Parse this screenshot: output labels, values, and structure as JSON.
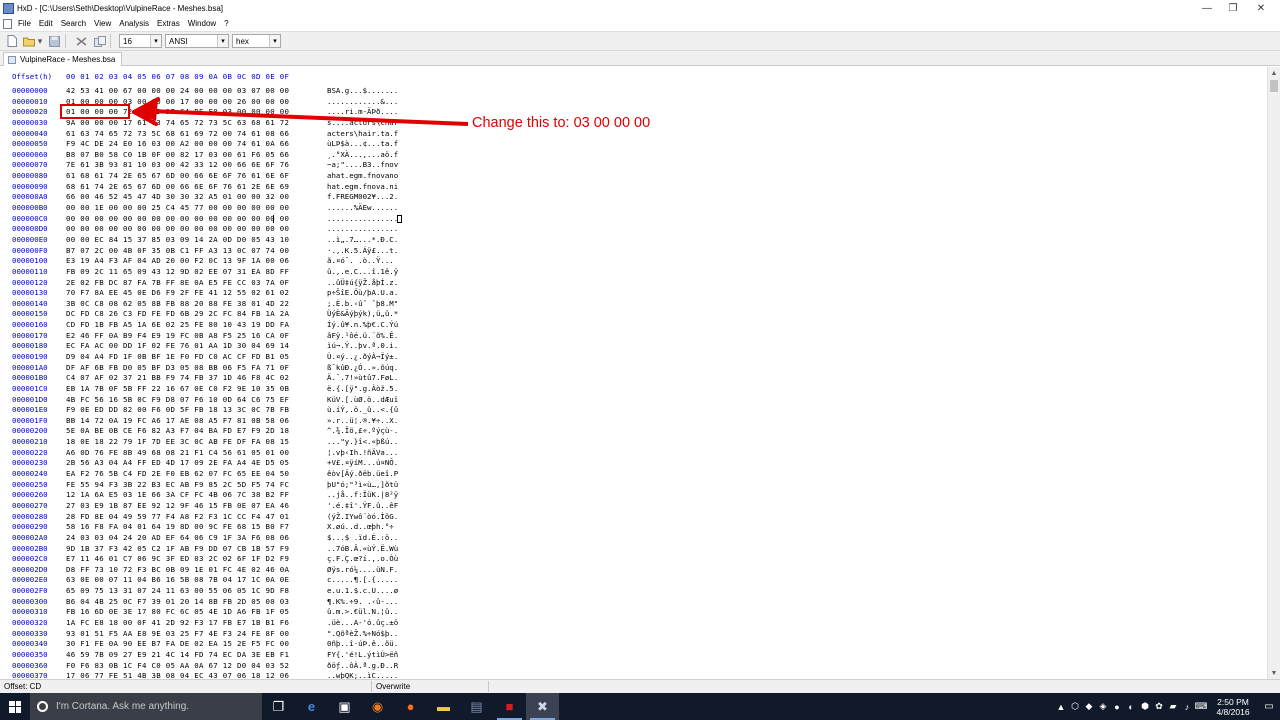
{
  "window": {
    "title": "HxD - [C:\\Users\\Seth\\Desktop\\VulpineRace - Meshes.bsa]",
    "controls": {
      "minimize": "—",
      "restore": "❐",
      "close": "✕"
    }
  },
  "menu": [
    "File",
    "Edit",
    "Search",
    "View",
    "Analysis",
    "Extras",
    "Window",
    "?"
  ],
  "toolbar": {
    "bytes_per_row": "16",
    "charset": "ANSI",
    "display_mode": "hex"
  },
  "tabs": [
    {
      "label": "VulpineRace - Meshes.bsa",
      "active": true
    }
  ],
  "hex_view": {
    "header_label": "Offset(h)",
    "columns": "00 01 02 03 04 05 06 07 08 09 0A 0B 0C 0D 0E 0F",
    "rows": [
      {
        "offset": "00000000",
        "hex": "42 53 41 00 67 00 00 00 24 00 00 00 03 07 00 00",
        "ascii": "BSA.g...$......."
      },
      {
        "offset": "00000010",
        "hex": "01 00 00 00 03 00 00 00 17 00 00 00 26 00 00 00",
        "ascii": "............&..."
      },
      {
        "offset": "00000020",
        "hex": "01 00 00 00 72 69 6D 97 C4 BE F0 03 00 00 00 00",
        "ascii": "....ri.m-ÄÞð...."
      },
      {
        "offset": "00000030",
        "hex": "9A 00 00 00 17 61 63 74 65 72 73 5C 63 68 61 72",
        "ascii": "š....actors\\char"
      },
      {
        "offset": "00000040",
        "hex": "61 63 74 65 72 73 5C 68 61 69 72 00 74 61 08 66",
        "ascii": "acters\\hair.ta.f"
      },
      {
        "offset": "00000050",
        "hex": "F9 4C DE 24 E0 16 03 00 A2 00 00 00 74 61 0A 66",
        "ascii": "ùLÞ$à...¢...ta.f"
      },
      {
        "offset": "00000060",
        "hex": "B8 07 B0 58 C0 1B 0F 00 82 17 03 00 61 F6 05 66",
        "ascii": "¸.°XÀ...‚...aö.f"
      },
      {
        "offset": "00000070",
        "hex": "7E 61 3B 93 81 10 03 00 42 33 12 00 66 6E 6F 76",
        "ascii": "~a;\"....B3..fnov"
      },
      {
        "offset": "00000080",
        "hex": "61 68 61 74 2E 65 67 6D 00 66 6E 6F 76 61 6E 6F",
        "ascii": "ahat.egm.fnovano"
      },
      {
        "offset": "00000090",
        "hex": "68 61 74 2E 65 67 6D 00 66 6E 6F 76 61 2E 6E 69",
        "ascii": "hat.egm.fnova.ni"
      },
      {
        "offset": "000000A0",
        "hex": "66 00 46 52 45 47 4D 30 30 32 A5 01 00 00 32 00",
        "ascii": "f.FREGM002¥...2."
      },
      {
        "offset": "000000B0",
        "hex": "00 00 1E 00 00 00 25 C4 45 77 00 00 00 00 00 00",
        "ascii": "......%ÄEw......"
      },
      {
        "offset": "000000C0",
        "hex": "00 00 00 00 00 00 00 00 00 00 00 00 00 00 00 00",
        "ascii": "................"
      },
      {
        "offset": "000000D0",
        "hex": "00 00 00 00 00 00 00 00 00 00 00 00 00 00 00 00",
        "ascii": "................"
      },
      {
        "offset": "000000E0",
        "hex": "00 00 EC 84 15 37 85 03 09 14 2A 0D D0 05 43 10",
        "ascii": "..ì„.7…...*.Ð.C."
      },
      {
        "offset": "000000F0",
        "hex": "B7 07 2C 00 4B 0F 35 0B C1 FF A3 13 0C 07 74 00",
        "ascii": "·.,.K.5.Áÿ£...t."
      },
      {
        "offset": "00000100",
        "hex": "E3 19 A4 F3 AF 04 AD 20 00 F2 0C 13 9F 1A 00 06",
        "ascii": "ã.¤ó¯.­ .ò..Ÿ..."
      },
      {
        "offset": "00000110",
        "hex": "FB 09 2C 11 65 09 43 12 9D 02 EE 07 31 EA 8D FF",
        "ascii": "û.,.e.C...î.1ê.ÿ"
      },
      {
        "offset": "00000120",
        "hex": "2E 02 FB DC 87 FA 7B FF 8E 0A E5 FE CC 03 7A 0F",
        "ascii": "..ûÜ‡ú{ÿŽ.åþÌ.z."
      },
      {
        "offset": "00000130",
        "hex": "70 F7 8A EE 45 0E D6 F9 2F FE 41 12 55 02 61 02",
        "ascii": "p÷ŠîE.Öù/þA.U.a."
      },
      {
        "offset": "00000140",
        "hex": "3B 0C C8 08 62 05 8B FB 88 20 88 FE 38 01 4D 22",
        "ascii": ";.È.b.‹ûˆ ˆþ8.M\""
      },
      {
        "offset": "00000150",
        "hex": "DC FD C8 26 C3 FD FE FD 6B 29 2C FC 84 FB 1A 2A",
        "ascii": "ÜýÈ&Ãýþýk),ü„û.*"
      },
      {
        "offset": "00000160",
        "hex": "CD FD 1B FB A5 1A 6E 02 25 FE 80 10 43 19 DD FA",
        "ascii": "Íý.û¥.n.%þ€.C.Ýú"
      },
      {
        "offset": "00000170",
        "hex": "E2 46 FF 0A B9 F4 E9 19 FC 0B A8 F5 25 16 CA 0F",
        "ascii": "âFÿ.¹ôé.ü.¨õ%.Ê."
      },
      {
        "offset": "00000180",
        "hex": "EC FA AC 00 DD 1F 02 FE 76 01 AA 1D 30 04 69 14",
        "ascii": "ìú¬.Ý..þv.ª.0.i."
      },
      {
        "offset": "00000190",
        "hex": "D9 04 A4 FD 1F 0B BF 1E F0 FD C0 AC CF FD B1 05",
        "ascii": "Ù.¤ý..¿.ðýÀ¬Ïý±."
      },
      {
        "offset": "000001A0",
        "hex": "DF AF 6B FB D0 05 BF D3 05 08 BB 06 F5 FA 71 0F",
        "ascii": "ß¯kûÐ.¿Ó..».õúq."
      },
      {
        "offset": "000001B0",
        "hex": "C4 07 AF 02 37 21 BB F9 74 FB 37 1D 46 F8 4C 02",
        "ascii": "Ä.¯.7!»ùtû7.FøL."
      },
      {
        "offset": "000001C0",
        "hex": "EB 1A 7B 0F 5B FF 22 16 67 0E C0 F2 9E 10 35 0B",
        "ascii": "ë.{.[ÿ\".g.Àòž.5."
      },
      {
        "offset": "000001D0",
        "hex": "4B FC 56 16 5B 0C F9 D8 07 F6 10 0D 64 C6 75 EF",
        "ascii": "KüV.[.ùØ.ö..dÆuï"
      },
      {
        "offset": "000001E0",
        "hex": "F9 0E ED DD 82 00 F6 0D 5F FB 18 13 3C 0C 7B FB",
        "ascii": "ù.íÝ‚.ö._û..<.{û"
      },
      {
        "offset": "000001F0",
        "hex": "BB 14 72 0A 19 FC A6 17 AE 08 A5 F7 81 0B 58 06",
        "ascii": "».r..ü¦.®.¥÷..X."
      },
      {
        "offset": "00000200",
        "hex": "5E 0A BE 0B CE F6 82 A3 F7 04 BA FD E7 F9 2D 18",
        "ascii": "^.¾.Îö‚£÷.ºýçù-."
      },
      {
        "offset": "00000210",
        "hex": "18 0E 18 22 79 1F 7D EE 3C 0C AB FE DF FA 08 15",
        "ascii": "...\"y.}î<.«þßú.."
      },
      {
        "offset": "00000220",
        "hex": "A6 0D 76 FE 8B 49 68 08 21 F1 C4 56 61 05 01 00",
        "ascii": "¦.vþ‹Ih.!ñÄVa..."
      },
      {
        "offset": "00000230",
        "hex": "2B 56 A3 04 A4 FF ED 4D 17 09 2E FA A4 4E D5 05",
        "ascii": "+V£.¤ÿíM...ú¤NÕ."
      },
      {
        "offset": "00000240",
        "hex": "EA F2 76 5B C4 FD 2E F0 EB 62 07 FC 65 EE 04 50",
        "ascii": "êòv[Äý.ðëb.üeî.P"
      },
      {
        "offset": "00000250",
        "hex": "FE 55 94 F3 3B 22 B3 EC AB F9 85 2C 5D F5 74 FC",
        "ascii": "þU\"ó;\"³ì«ù…,]õtü"
      },
      {
        "offset": "00000260",
        "hex": "12 1A 6A E5 03 1E 66 3A CF FC 4B 06 7C 38 B2 FF",
        "ascii": "..jå..f:ÏüK.|8²ÿ"
      },
      {
        "offset": "00000270",
        "hex": "27 03 E9 1B 87 EE 92 12 9F 46 15 FB 0E 07 EA 46",
        "ascii": "'.é.‡î'.ŸF.û..êF"
      },
      {
        "offset": "00000280",
        "hex": "28 FD 8E 04 49 59 77 F4 A8 F2 F3 1C CC F4 47 01",
        "ascii": "(ýŽ.IYwô¨òó.ÌôG."
      },
      {
        "offset": "00000290",
        "hex": "58 16 F8 FA 04 01 64 19 8D 00 9C FE 68 15 B0 F7",
        "ascii": "X.øú..d..œþh.°÷"
      },
      {
        "offset": "000002A0",
        "hex": "24 03 03 04 24 20 AD EF 64 06 C9 1F 3A F6 08 06",
        "ascii": "$...$ .ïd.É.:ö.."
      },
      {
        "offset": "000002B0",
        "hex": "9D 1B 37 F3 42 05 C2 1F AB F9 DD 07 CB 1B 57 F9",
        "ascii": "..7óB.Â.«ùÝ.Ë.Wù"
      },
      {
        "offset": "000002C0",
        "hex": "E7 11 46 01 C7 06 9C 3F ED 03 2C 02 6F 1F D2 F9",
        "ascii": "ç.F.Ç.œ?í.,.o.Òù"
      },
      {
        "offset": "000002D0",
        "hex": "D8 FF 73 10 72 F3 BC 0B 09 1E 01 FC 4E 02 46 0A",
        "ascii": "Øÿs.ró¼....üN.F."
      },
      {
        "offset": "000002E0",
        "hex": "63 0E 00 07 11 04 B6 16 5B 08 7B 04 17 1C 0A 0E",
        "ascii": "c.....¶.[.{....."
      },
      {
        "offset": "000002F0",
        "hex": "65 09 75 13 31 07 24 11 63 00 55 06 05 1C 9D F8",
        "ascii": "e.u.1.$.c.U....ø"
      },
      {
        "offset": "00000300",
        "hex": "B6 04 4B 25 0C F7 39 01 20 14 8B FB 2D 05 00 03",
        "ascii": "¶.K%.÷9. .‹û-..."
      },
      {
        "offset": "00000310",
        "hex": "FB 16 6D 0E 3E 17 80 FC 6C 05 4E 1D A6 FB 1F 05",
        "ascii": "û.m.>.€ül.N.¦û.."
      },
      {
        "offset": "00000320",
        "hex": "1A FC E8 18 00 0F 41 2D 92 F3 17 FB E7 1B B1 F6",
        "ascii": ".üè...A-'ó.ûç.±ö"
      },
      {
        "offset": "00000330",
        "hex": "93 01 51 F5 AA E8 9E 03 25 F7 4E F3 24 FE 8F 00",
        "ascii": "\".QõªèŽ.%÷Nó$þ.."
      },
      {
        "offset": "00000340",
        "hex": "30 F1 FE 0A 90 EE B7 FA DE 02 EA 15 2E F5 FC 00",
        "ascii": "0ñþ..î·úÞ.ê..õü."
      },
      {
        "offset": "00000350",
        "hex": "46 59 7B 09 27 E9 21 4C 14 FD 74 EC DA 3E EB F1",
        "ascii": "FY{.'é!L.ýtìÚ>ëñ"
      },
      {
        "offset": "00000360",
        "hex": "F0 F6 83 0B 1C F4 C0 05 AA 0A 67 12 D0 04 03 52",
        "ascii": "ðöƒ..ôÀ.ª.g.Ð..R"
      },
      {
        "offset": "00000370",
        "hex": "17 06 77 FE 51 4B 3B 08 04 EC 43 07 06 18 12 06",
        "ascii": "..wþQK;..ìC....."
      }
    ]
  },
  "annotation": {
    "text": "Change this to: 03 00 00 00",
    "color": "#e00000"
  },
  "status": {
    "offset": "Offset: CD",
    "mode": "Overwrite"
  },
  "taskbar": {
    "search_placeholder": "I'm Cortana. Ask me anything.",
    "time": "2:50 PM",
    "date": "4/8/2016"
  }
}
